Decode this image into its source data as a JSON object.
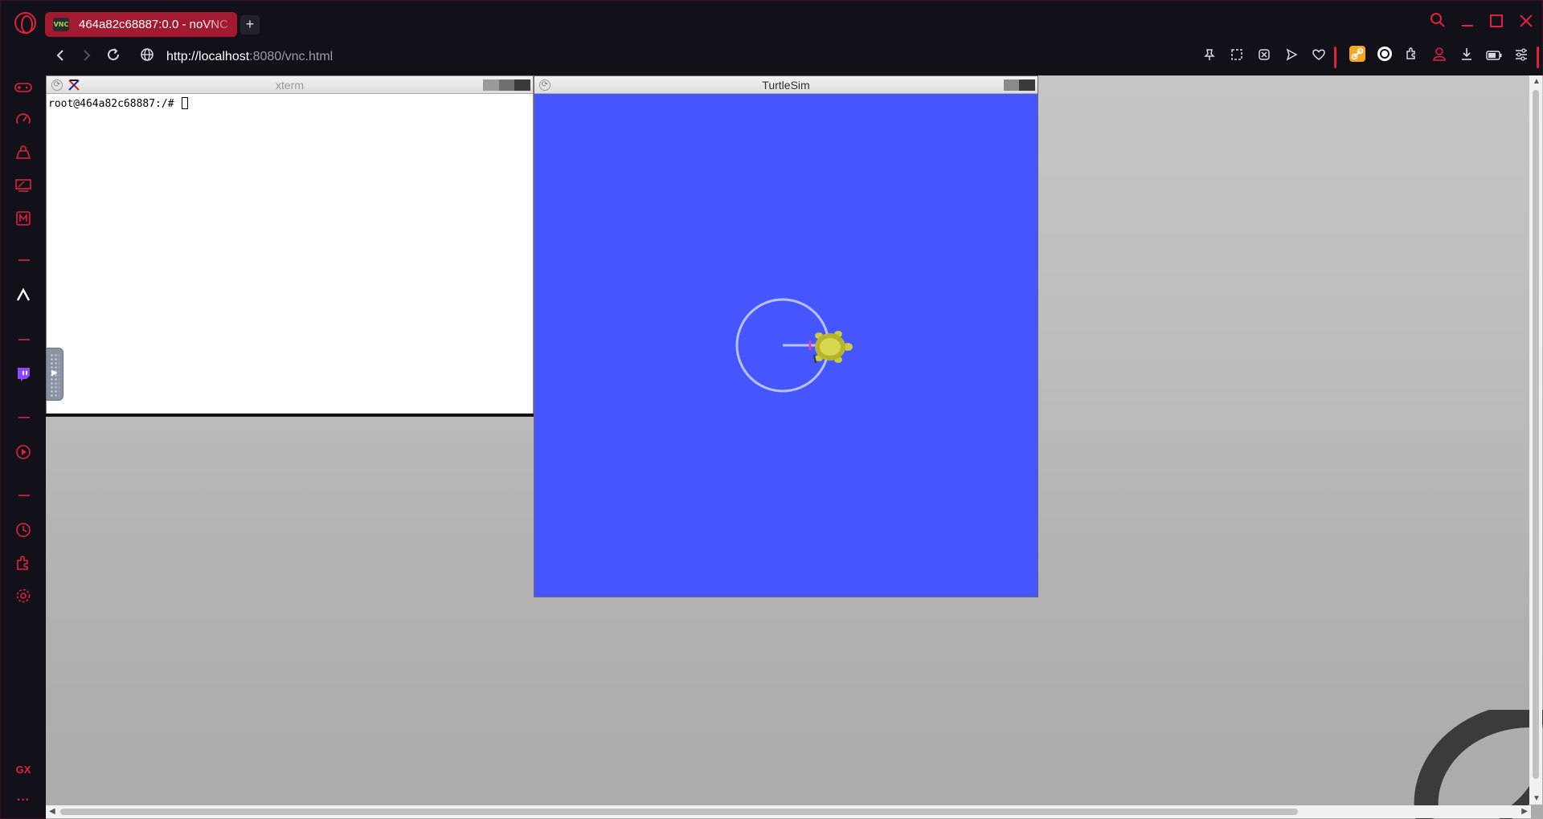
{
  "browser": {
    "tab": {
      "title": "464a82c68887:0.0 - noVNC",
      "favicon_text": "VNC"
    },
    "new_tab_label": "+",
    "address": {
      "host": "http://localhost",
      "rest": ":8080/vnc.html"
    }
  },
  "sidebar": {
    "gx_label": "GX",
    "more_label": "···"
  },
  "desktop": {
    "xterm": {
      "title": "xterm",
      "prompt": "root@464a82c68887:/# "
    },
    "turtlesim": {
      "title": "TurtleSim",
      "background_color": "#4556ff"
    }
  },
  "colors": {
    "accent": "#e0223f",
    "tab_active": "#a21a30"
  }
}
